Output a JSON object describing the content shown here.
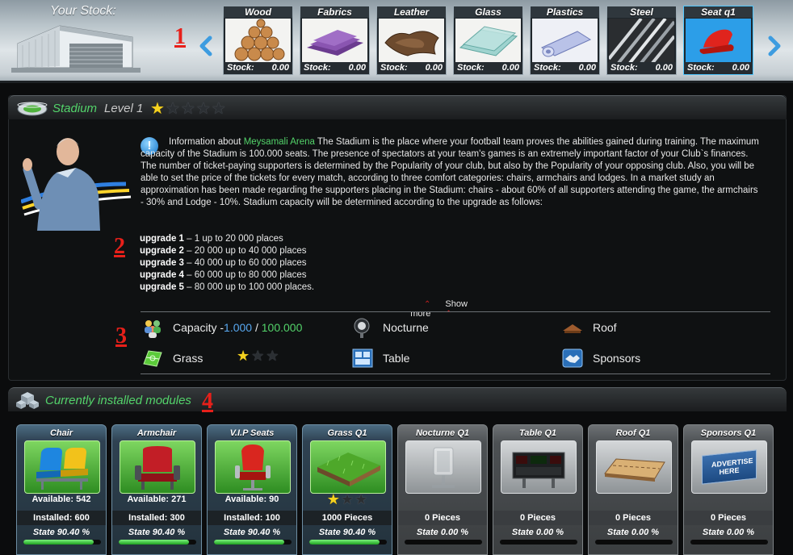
{
  "stock_bar": {
    "title": "Your Stock:",
    "marker": "1",
    "prev_icon": "chevron-left-icon",
    "next_icon": "chevron-right-icon",
    "resources": [
      {
        "name": "Wood",
        "stock_label": "Stock:",
        "stock_value": "0.00",
        "icon": "wood-logs-icon"
      },
      {
        "name": "Fabrics",
        "stock_label": "Stock:",
        "stock_value": "0.00",
        "icon": "fabric-icon"
      },
      {
        "name": "Leather",
        "stock_label": "Stock:",
        "stock_value": "0.00",
        "icon": "leather-icon"
      },
      {
        "name": "Glass",
        "stock_label": "Stock:",
        "stock_value": "0.00",
        "icon": "glass-icon"
      },
      {
        "name": "Plastics",
        "stock_label": "Stock:",
        "stock_value": "0.00",
        "icon": "plastic-roll-icon"
      },
      {
        "name": "Steel",
        "stock_label": "Stock:",
        "stock_value": "0.00",
        "icon": "steel-rods-icon"
      },
      {
        "name": "Seat q1",
        "stock_label": "Stock:",
        "stock_value": "0.00",
        "icon": "seat-icon"
      }
    ]
  },
  "stadium": {
    "title": "Stadium",
    "level": "Level 1",
    "stars_filled": 1,
    "stars_total": 5,
    "info_prefix": "Information about ",
    "arena_name": "Meysamali Arena",
    "info_body": " The Stadium is the place where your football team proves the abilities gained during training. The maximum capacity of the Stadium is 100.000 seats. The presence of spectators at your team's games is an extremely important factor of your Club`s finances. The number of ticket-paying supporters is determined by the Popularity of your club, but also by the Popularity of your opposing club. Also, you will be able to set the price of the tickets for every match, according to three comfort categories: chairs, armchairs and lodges. In a market study an approximation has been made regarding the supporters placing in the Stadium: chairs - about 60% of all supporters attending the game, the armchairs - 30% and Lodge - 10%. Stadium capacity will be determined according to the upgrade as follows:",
    "upgrades": [
      {
        "label": "upgrade 1",
        "text": " – 1 up to 20 000 places"
      },
      {
        "label": "upgrade 2",
        "text": " – 20 000 up to 40 000 places"
      },
      {
        "label": "upgrade 3",
        "text": " – 40 000 up to 60 000 places"
      },
      {
        "label": "upgrade 4",
        "text": " – 60 000 up to 80 000 places"
      },
      {
        "label": "upgrade 5",
        "text": " – 80 000 up to 100 000 places."
      }
    ],
    "show_more": "Show more",
    "marker_2": "2",
    "marker_3": "3"
  },
  "facilities": {
    "capacity_label": "Capacity - ",
    "capacity_current": "1.000",
    "capacity_sep": " / ",
    "capacity_max": "100.000",
    "nocturne": "Nocturne",
    "roof": "Roof",
    "grass": "Grass",
    "grass_stars_filled": 1,
    "grass_stars_total": 3,
    "table": "Table",
    "sponsors": "Sponsors"
  },
  "modules_section": {
    "title": "Currently installed modules",
    "marker": "4",
    "modules": [
      {
        "name": "Chair",
        "line1": "Available: 542",
        "line2": "Installed: 600",
        "state": "State 90.40 %",
        "state_fraction": 0.904,
        "active": true,
        "icon": "stadium-chairs-icon"
      },
      {
        "name": "Armchair",
        "line1": "Available: 271",
        "line2": "Installed: 300",
        "state": "State 90.40 %",
        "state_fraction": 0.904,
        "active": true,
        "icon": "armchair-icon"
      },
      {
        "name": "V.I.P Seats",
        "line1": "Available: 90",
        "line2": "Installed: 100",
        "state": "State 90.40 %",
        "state_fraction": 0.904,
        "active": true,
        "icon": "vip-seat-icon"
      },
      {
        "name": "Grass Q1",
        "line1": "",
        "line2": "1000 Pieces",
        "state": "State 90.40 %",
        "state_fraction": 0.904,
        "active": true,
        "stars_filled": 1,
        "stars_total": 3,
        "icon": "grass-turf-icon"
      },
      {
        "name": "Nocturne Q1",
        "line1": "",
        "line2": "0 Pieces",
        "state": "State 0.00 %",
        "state_fraction": 0,
        "active": false,
        "icon": "floodlight-icon"
      },
      {
        "name": "Table Q1",
        "line1": "",
        "line2": "0 Pieces",
        "state": "State 0.00 %",
        "state_fraction": 0,
        "active": false,
        "icon": "scoreboard-icon"
      },
      {
        "name": "Roof Q1",
        "line1": "",
        "line2": "0 Pieces",
        "state": "State 0.00 %",
        "state_fraction": 0,
        "active": false,
        "icon": "roof-panel-icon"
      },
      {
        "name": "Sponsors Q1",
        "line1": "",
        "line2": "0 Pieces",
        "state": "State 0.00 %",
        "state_fraction": 0,
        "active": false,
        "billboard_text": "ADVERTISE HERE",
        "icon": "billboard-icon"
      }
    ]
  },
  "colors": {
    "accent_green": "#53d36a",
    "marker_red": "#e7201a",
    "capacity_blue": "#58a8f0",
    "star_gold": "#f5d21f"
  }
}
